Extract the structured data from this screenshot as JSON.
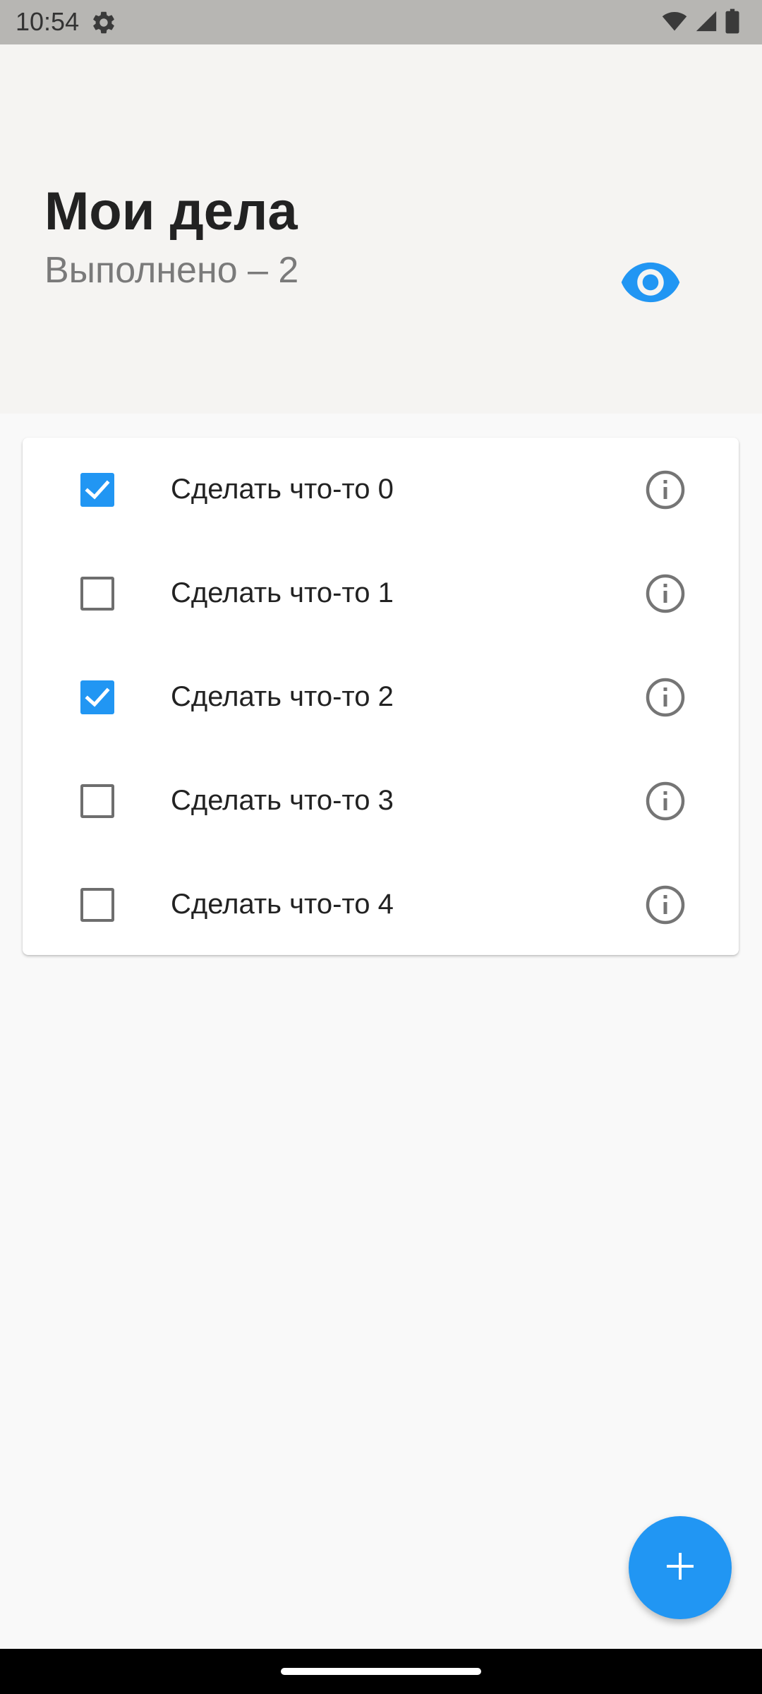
{
  "status_bar": {
    "time": "10:54",
    "icons": [
      "settings-gear-icon",
      "wifi-icon",
      "signal-icon",
      "battery-icon"
    ]
  },
  "header": {
    "title": "Мои дела",
    "subtitle": "Выполнено – 2",
    "visibility_icon": "eye-icon"
  },
  "tasks": [
    {
      "label": "Сделать что-то 0",
      "checked": true
    },
    {
      "label": "Сделать что-то 1",
      "checked": false
    },
    {
      "label": "Сделать что-то 2",
      "checked": true
    },
    {
      "label": "Сделать что-то 3",
      "checked": false
    },
    {
      "label": "Сделать что-то 4",
      "checked": false
    }
  ],
  "fab": {
    "icon": "plus-icon"
  },
  "colors": {
    "accent": "#2196f3",
    "header_bg": "#f5f4f2",
    "page_bg": "#f9f9f9",
    "status_bar_bg": "#b7b6b3"
  }
}
